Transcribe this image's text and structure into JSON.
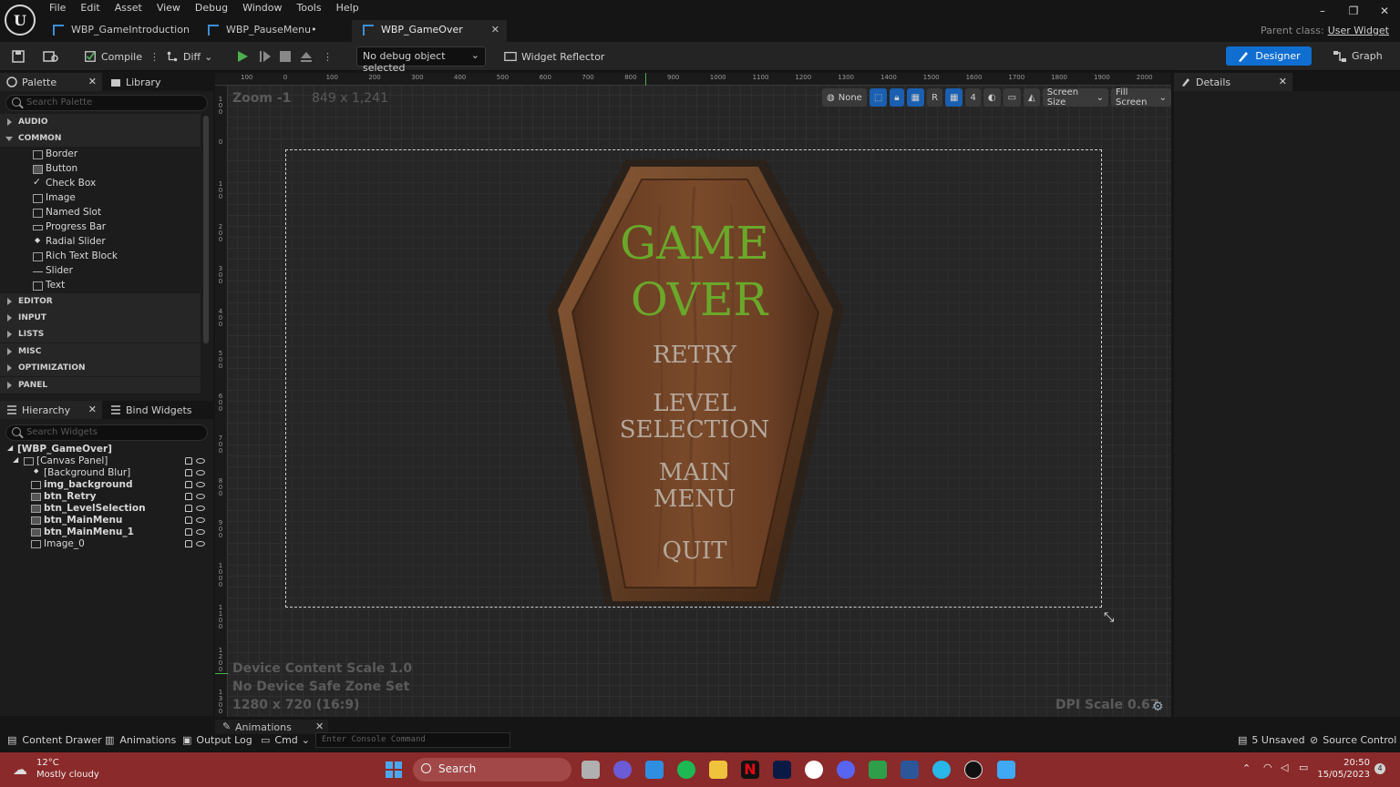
{
  "menu": [
    "File",
    "Edit",
    "Asset",
    "View",
    "Debug",
    "Window",
    "Tools",
    "Help"
  ],
  "tabs": [
    {
      "label": "WBP_GameIntroduction",
      "active": false
    },
    {
      "label": "WBP_PauseMenu•",
      "active": false
    },
    {
      "label": "WBP_GameOver",
      "active": true
    }
  ],
  "parent_class": {
    "label": "Parent class:",
    "value": "User Widget"
  },
  "window_controls": [
    "–",
    "❐",
    "✕"
  ],
  "toolbar": {
    "compile": "Compile",
    "diff": "Diff",
    "debug_select": "No debug object selected",
    "widget_reflector": "Widget Reflector",
    "designer": "Designer",
    "graph": "Graph"
  },
  "palette": {
    "tab": "Palette",
    "library_tab": "Library",
    "search_placeholder": "Search Palette",
    "categories_top": [
      "AUDIO",
      "COMMON"
    ],
    "common_items": [
      "Border",
      "Button",
      "Check Box",
      "Image",
      "Named Slot",
      "Progress Bar",
      "Radial Slider",
      "Rich Text Block",
      "Slider",
      "Text"
    ],
    "categories_bottom": [
      "EDITOR",
      "INPUT",
      "LISTS",
      "MISC",
      "OPTIMIZATION",
      "PANEL"
    ]
  },
  "hierarchy": {
    "tab": "Hierarchy",
    "bind_tab": "Bind Widgets",
    "search_placeholder": "Search Widgets",
    "items": [
      "[WBP_GameOver]",
      "[Canvas Panel]",
      "[Background Blur]",
      "img_background",
      "btn_Retry",
      "btn_LevelSelection",
      "btn_MainMenu",
      "btn_MainMenu_1",
      "Image_0"
    ]
  },
  "viewport": {
    "zoom": "Zoom -1",
    "resolution": "849 x 1,241",
    "none_label": "None",
    "r_label": "R",
    "grid_value": "4",
    "screen_size": "Screen Size",
    "fill_screen": "Fill Screen",
    "device_scale": "Device Content Scale 1.0",
    "safe_zone": "No Device Safe Zone Set",
    "size_info": "1280 x 720 (16:9)",
    "dpi": "DPI Scale 0.67",
    "ruler_h": [
      "100",
      "0",
      "100",
      "200",
      "300",
      "400",
      "500",
      "600",
      "700",
      "800",
      "900",
      "1000",
      "1100",
      "1200",
      "1300",
      "1400",
      "1500",
      "1600",
      "1700",
      "1800",
      "1900",
      "2000"
    ],
    "ruler_v": [
      "100",
      "0",
      "100",
      "200",
      "300",
      "400",
      "500",
      "600",
      "700",
      "800",
      "900",
      "1000",
      "1100",
      "1200",
      "1300"
    ]
  },
  "game_over": {
    "title_line1": "GAME",
    "title_line2": "OVER",
    "retry": "RETRY",
    "level_line1": "LEVEL",
    "level_line2": "SELECTION",
    "main_line1": "MAIN",
    "main_line2": "MENU",
    "quit": "QUIT",
    "title_color": "#6aa82a",
    "button_color": "#b5a89c"
  },
  "details": {
    "tab": "Details"
  },
  "bottom_bar": {
    "content_drawer": "Content Drawer",
    "animations": "Animations",
    "output_log": "Output Log",
    "cmd": "Cmd",
    "console_placeholder": "Enter Console Command",
    "animations_tab": "Animations",
    "unsaved": "5 Unsaved",
    "source_control": "Source Control"
  },
  "taskbar": {
    "weather_temp": "12°C",
    "weather_desc": "Mostly cloudy",
    "search": "Search",
    "time": "20:50",
    "date": "15/05/2023",
    "notif": "4"
  }
}
